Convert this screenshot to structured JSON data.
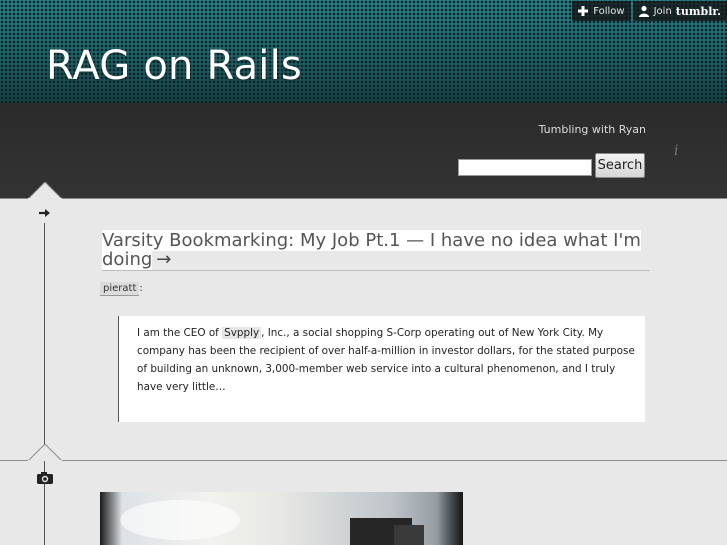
{
  "site": {
    "title": "RAG on Rails",
    "tagline": "Tumbling with Ryan"
  },
  "tumblr_controls": {
    "follow_label": "Follow",
    "join_label": "Join",
    "brand": "tumblr."
  },
  "search": {
    "placeholder": "",
    "value": "",
    "button_label": "Search"
  },
  "info_icon": "i",
  "posts": [
    {
      "type_icon": "arrow-right-icon",
      "title": "Varsity Bookmarking: My Job Pt.1 — I have no idea what I'm doing",
      "title_arrow": "→",
      "attribution_name": "pieratt",
      "attribution_suffix": ":",
      "quote_pre": "I am the CEO of ",
      "quote_link": "Svpply",
      "quote_post": ", Inc., a social shopping S-Corp operating out of New York City. My company has been the recipient of over half-a-million in investor dollars, for the stated purpose of building an unknown, 3,000-member web service into a cultural phenomenon, and I truly have very little…"
    },
    {
      "type_icon": "camera-icon"
    }
  ],
  "colors": {
    "header": "#1f6168",
    "band": "#2f2f2f",
    "page_bg": "#e8e8e8"
  }
}
